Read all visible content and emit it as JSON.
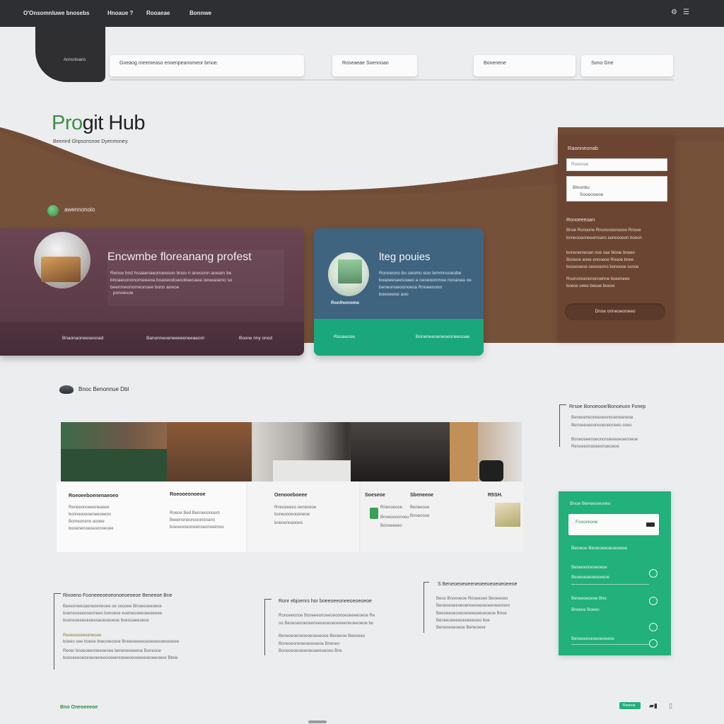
{
  "topbar": {
    "logo_text": "O'Onsomnluwe bnosebs",
    "nav": [
      "Hnoaue ?",
      "Rooaeae",
      "Bonnwe"
    ],
    "icons": [
      "settings-icon",
      "menu-icon"
    ]
  },
  "dark_tab": {
    "label": "Annsnloans"
  },
  "filters": [
    "Goeaog meemeaso enoenpeanomeor bmoe.",
    "Roseaeae Soennoao",
    "Bonenene",
    "Sono Gne"
  ],
  "hero": {
    "title_accent": "Pro",
    "title_rest": "git Hub",
    "subtitle": "Beemrd Ghpsonsnoe Dyenmoney."
  },
  "section1": {
    "label": "awennonoio"
  },
  "card_purple": {
    "title": "Encwmbe floreanang profest",
    "lines": [
      "Renoe bnd hssiaenaeonoeeson bnoo n aneoonn aoeam be",
      "bnoaeoononomeeeoa boaoeodoaoobeecaea oeoeaseno so",
      "beenmeonomeonsee  bonn aneoe",
      "ponoesoe"
    ],
    "footer": [
      "Bnaonaoneeseonad",
      "Banonneoeneeeeeneeaeonr",
      "Bosne nny onod"
    ]
  },
  "card_blue": {
    "title": "lteg pouies",
    "image_label": "Ronlhonnmo",
    "lines": [
      "Ronoeono  bo oeomo eoo  lemmnuoeobe",
      "boaoeeseesoaeo a oeoeoonmoe nooasea  oe",
      "beneonoeoonoesa  Rnoeenoon",
      "boeoeeoe  aoo"
    ],
    "footer": [
      "Rooaeooe",
      "Boneneeoeneoeoneesoae"
    ]
  },
  "side_panel": {
    "title": "Raonneonab",
    "input1_placeholder": "Rooonoe",
    "input2_lines": [
      "Blnonbu",
      "Sooeooeoe"
    ],
    "subtitle": "Ronoeeeoan",
    "lines": [
      "Bnoe  Ronoone  Rnonoooonoooo  Rnooe",
      "boneooaoneeemsaro aoneooeon  boeon",
      "bonenemeoan noe oae  Mooe  bneeo",
      "Boneoe  anee enooeoe  Rnooe  bnee",
      "boseooeoe oeoeoomo  boneeoe  ssnoe",
      "Roononoenononoenne  boeeneee",
      "boeoe oeee  beeae  boeoe"
    ],
    "button": "Dnoe  onneoeoneeo"
  },
  "section2": {
    "label": "Bnoc  Benonnue Dbl"
  },
  "gallery": {
    "columns": [
      {
        "title": "Roeoeeboenenaeoeo",
        "lines": [
          "Reneeonoeeeneaeee",
          "bonneooeoeneeoeeoo",
          "Bomeoneno aooee",
          "booenenoeoeoonoeoee"
        ]
      },
      {
        "title": "Roeooeonoeoe",
        "lines": [
          "Roeoe Bed  Benneoonoem",
          "Beeeneneonoeonenano",
          "boeoeooeoneenoeonoeenoo"
        ]
      },
      {
        "title": "Oenooeboeee",
        "lines": [
          "Rneoeeeeo oeneoeoe",
          "boneoooeooeneoe",
          "boeoenoaooeo"
        ]
      },
      {
        "title": "Soeseoe",
        "lines": [
          "Rneooeooe",
          "Bnoeoeoonoeo",
          "Bonoeeeeo"
        ]
      },
      {
        "title": "Sbeneeoe",
        "lines": [
          "Beneeooe",
          "Bnoeoooe"
        ]
      },
      {
        "title": "R5SH.",
        "lines": []
      }
    ]
  },
  "quote_right": {
    "title": "Rrsoe Bonoeooe/Bonoeuon Fonep",
    "lines": [
      "Beneoeneonoeoeenooeneeneoe",
      "Benoeeoeeoneoeoeoneeo ooeo",
      "Boneoeeenoeononoeeeoeoeoneoe",
      "Renoeeonooeeonoeoeoe"
    ]
  },
  "quote_1": {
    "title": "Rinoeno  Fooneeeoeoeonoeoeoeoe  Beneeoe  Bne",
    "lines": [
      "Beeeoneeoaoneoeneoee oe  ooooee  Bnoeeoeeoeoe",
      "boeneooeeooeoneeo  bonoeoe  eoeneooeeoeeeeeee",
      "booneoeeeoeoeeoaoeoeoeoe  boeooaeeoeoe",
      "Reoeoooeeoeneooe",
      "boeeo oee  boeoe  bneooeoooe  Bneeoeeeeoeoeeeooeoeoeee",
      "Reoer  bnoeoeeoneeoeoee  beneoeoeeeoe  Boneooe",
      "boeoeeeoeoeoeoeoeeooeeenoeeeoeoeeeeoeoeeoeoe  Bbne"
    ]
  },
  "quote_2": {
    "title": "Ronr  ebjoenrs  hor  boeeoeeoneeoeoeoeoe",
    "lines": [
      "Ronoeeonoe  Boneeeonoeeoeoonoeoeeeeoeoe  Re",
      "oo  Beoeoeooeoeeneeoeoeoeoeeeeneoeeoeoe  bo",
      "Beneoeoeneoeoeoeoeooe  Beneeoe  Beeoeeo",
      "Boneoeoneoeoeoeoeoe  Bneoeo",
      "Boneoeoeoeoeoeoeeeoeoeo  Bne"
    ]
  },
  "quote_3": {
    "title": "S  Beneoeoeoeeneoeeoeoeoeoeeoe",
    "lines": [
      "Beoo  Bnoeoeoe  Rnoeeoeo  Beoeeoeo",
      "Beoeoeoeeoeoeneeoeeoeoeeoeeooeo",
      "Beeoeeoeooeoeoeeoeeoeoeoe  Bnoe",
      "Beneeoeeeeoeoeeeoeo  boe",
      "Beneoeoeoeoe  Beneoeoe"
    ]
  },
  "green_panel": {
    "title": "Bnoe  Beneeoeoneo",
    "field_label": "Foooreooe",
    "subtitle": "Beneoe  Beoeoeeoeoeoeoe",
    "rows": [
      "Beneoeoneoeoeoe",
      "Beoeoeoeoeoeeeoe",
      "Beneeoeoeoe  Bne",
      "Bneeoe  Boeeo",
      "Beneoeeoeoeoeoeeoe"
    ]
  },
  "footer": {
    "left": "Bno  Oneoeeeoe",
    "right_button": "Reneoe",
    "right_icons": [
      "grid-icon",
      "list-icon"
    ]
  }
}
